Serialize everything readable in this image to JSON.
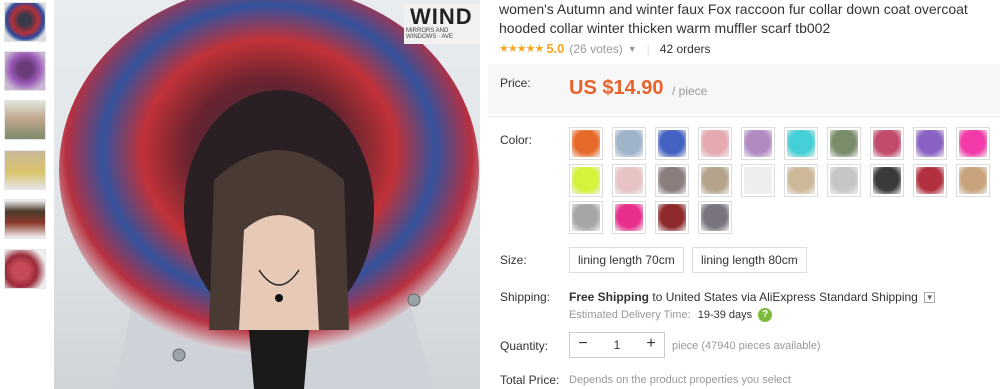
{
  "product": {
    "title": "women's Autumn and winter faux Fox raccoon fur collar down coat overcoat hooded collar winter thicken warm muffler scarf tb002",
    "rating": {
      "stars": "★★★★★",
      "score": "5.0",
      "votes": "(26 votes)",
      "orders": "42 orders"
    }
  },
  "image": {
    "sign_text": "WIND",
    "sign_subtext": "MIRRORS AND WINDOWS · AVE"
  },
  "price": {
    "label": "Price:",
    "value": "US $14.90",
    "unit": "/ piece"
  },
  "color": {
    "label": "Color:",
    "swatches": [
      {
        "name": "orange-fur",
        "color": "#e86a2a"
      },
      {
        "name": "light-blue-fur",
        "color": "#9fb3c9"
      },
      {
        "name": "blue-fur",
        "color": "#4462c2"
      },
      {
        "name": "pink-fur",
        "color": "#e4aab0"
      },
      {
        "name": "lilac-fur",
        "color": "#b08ac0"
      },
      {
        "name": "aqua-fur",
        "color": "#44d0d6"
      },
      {
        "name": "green-brown-fur",
        "color": "#7a8d6a"
      },
      {
        "name": "rose-fur",
        "color": "#c24a6a"
      },
      {
        "name": "purple-fur",
        "color": "#8a62c4"
      },
      {
        "name": "hot-pink-fur",
        "color": "#f23aa8"
      },
      {
        "name": "neon-yellow-fur",
        "color": "#d6f23a"
      },
      {
        "name": "pale-pink-fur",
        "color": "#e7c3c4"
      },
      {
        "name": "grey-brown-fur",
        "color": "#8a7f7c"
      },
      {
        "name": "natural-fur",
        "color": "#b2a38a"
      },
      {
        "name": "white-fur",
        "color": "#eeeeee"
      },
      {
        "name": "beige-fur",
        "color": "#cdb89a"
      },
      {
        "name": "silver-fur",
        "color": "#c6c6c6"
      },
      {
        "name": "black-fur",
        "color": "#3a3a3a"
      },
      {
        "name": "red-mix-fur",
        "color": "#b23040"
      },
      {
        "name": "camel-fur",
        "color": "#c7a27a"
      },
      {
        "name": "grey-fur",
        "color": "#a6a6a6"
      },
      {
        "name": "magenta-fur",
        "color": "#e82f8c"
      },
      {
        "name": "dark-red-fur",
        "color": "#8e2a2c"
      },
      {
        "name": "slate-fur",
        "color": "#7a7480"
      }
    ]
  },
  "size": {
    "label": "Size:",
    "options": [
      "lining length 70cm",
      "lining length 80cm"
    ]
  },
  "shipping": {
    "label": "Shipping:",
    "free_text": "Free Shipping",
    "to_text": "to United States via AliExpress Standard Shipping",
    "estimated_label": "Estimated Delivery Time:",
    "estimated_days": "19-39 days",
    "help": "?"
  },
  "quantity": {
    "label": "Quantity:",
    "minus": "−",
    "value": "1",
    "plus": "+",
    "note": "piece (47940 pieces available)"
  },
  "total": {
    "label": "Total Price:",
    "note": "Depends on the product properties you select"
  }
}
